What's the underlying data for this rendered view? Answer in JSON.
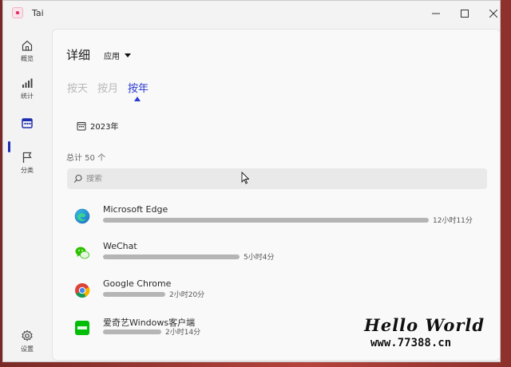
{
  "window": {
    "title": "Tai",
    "controls": {
      "minimize_icon": "minimize-icon",
      "maximize_icon": "maximize-icon",
      "close_icon": "close-icon"
    }
  },
  "sidebar": {
    "items": [
      {
        "label": "概览",
        "icon": "home-icon"
      },
      {
        "label": "统计",
        "icon": "bar-chart-icon"
      },
      {
        "label": "",
        "icon": "calendar-icon",
        "active": true
      },
      {
        "label": "分类",
        "icon": "flag-icon"
      }
    ],
    "settings": {
      "label": "设置",
      "icon": "gear-icon"
    }
  },
  "page": {
    "title": "详细",
    "dropdown_value": "应用",
    "tabs": [
      "按天",
      "按月",
      "按年"
    ],
    "active_tab": 2,
    "year": "2023年",
    "total": "总计 50 个",
    "search_placeholder": "搜索"
  },
  "apps": [
    {
      "name": "Microsoft Edge",
      "duration": "12小时11分",
      "share": 1.0,
      "icon": "edge-icon",
      "color": "#1f8fd8"
    },
    {
      "name": "WeChat",
      "duration": "5小时4分",
      "share": 0.42,
      "icon": "wechat-icon",
      "color": "#2dc100"
    },
    {
      "name": "Google Chrome",
      "duration": "2小时20分",
      "share": 0.19,
      "icon": "chrome-icon",
      "color": "#db4437"
    },
    {
      "name": "爱奇艺Windows客户端",
      "duration": "2小时14分",
      "share": 0.18,
      "icon": "iqiyi-icon",
      "color": "#00be06"
    }
  ],
  "watermark": {
    "title": "Hello World",
    "url": "www.77388.cn"
  },
  "colors": {
    "accent": "#2b3ad0",
    "bar": "#b5b5b5"
  }
}
